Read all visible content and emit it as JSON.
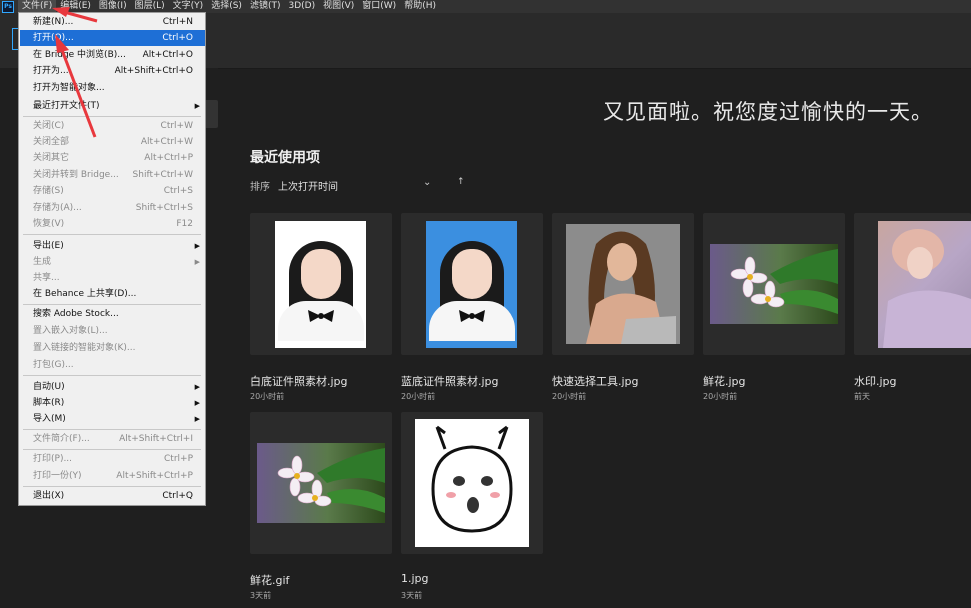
{
  "menubar": {
    "logo": "Ps",
    "items": [
      "文件(F)",
      "编辑(E)",
      "图像(I)",
      "图层(L)",
      "文字(Y)",
      "选择(S)",
      "滤镜(T)",
      "3D(D)",
      "视图(V)",
      "窗口(W)",
      "帮助(H)"
    ]
  },
  "welcome": "又见面啦。祝您度过愉快的一天。",
  "recent": {
    "title": "最近使用项",
    "sort_label": "排序",
    "sort_value": "上次打开时间",
    "sort_up": "↑",
    "files": [
      {
        "name": "白底证件照素材.jpg",
        "time": "20小时前"
      },
      {
        "name": "蓝底证件照素材.jpg",
        "time": "20小时前"
      },
      {
        "name": "快速选择工具.jpg",
        "time": "20小时前"
      },
      {
        "name": "鲜花.jpg",
        "time": "20小时前"
      },
      {
        "name": "水印.jpg",
        "time": "前天"
      },
      {
        "name": "鲜花.gif",
        "time": "3天前"
      },
      {
        "name": "1.jpg",
        "time": "3天前"
      }
    ]
  },
  "file_menu": {
    "items": [
      {
        "label": "新建(N)...",
        "shortcut": "Ctrl+N"
      },
      {
        "label": "打开(O)...",
        "shortcut": "Ctrl+O"
      },
      {
        "label": "在 Bridge 中浏览(B)...",
        "shortcut": "Alt+Ctrl+O"
      },
      {
        "label": "打开为...",
        "shortcut": "Alt+Shift+Ctrl+O"
      },
      {
        "label": "打开为智能对象...",
        "shortcut": ""
      },
      {
        "label": "最近打开文件(T)",
        "shortcut": ""
      },
      {
        "label": "关闭(C)",
        "shortcut": "Ctrl+W"
      },
      {
        "label": "关闭全部",
        "shortcut": "Alt+Ctrl+W"
      },
      {
        "label": "关闭其它",
        "shortcut": "Alt+Ctrl+P"
      },
      {
        "label": "关闭并转到 Bridge...",
        "shortcut": "Shift+Ctrl+W"
      },
      {
        "label": "存储(S)",
        "shortcut": "Ctrl+S"
      },
      {
        "label": "存储为(A)...",
        "shortcut": "Shift+Ctrl+S"
      },
      {
        "label": "恢复(V)",
        "shortcut": "F12"
      },
      {
        "label": "导出(E)",
        "shortcut": ""
      },
      {
        "label": "生成",
        "shortcut": ""
      },
      {
        "label": "共享...",
        "shortcut": ""
      },
      {
        "label": "在 Behance 上共享(D)...",
        "shortcut": ""
      },
      {
        "label": "搜索 Adobe Stock...",
        "shortcut": ""
      },
      {
        "label": "置入嵌入对象(L)...",
        "shortcut": ""
      },
      {
        "label": "置入链接的智能对象(K)...",
        "shortcut": ""
      },
      {
        "label": "打包(G)...",
        "shortcut": ""
      },
      {
        "label": "自动(U)",
        "shortcut": ""
      },
      {
        "label": "脚本(R)",
        "shortcut": ""
      },
      {
        "label": "导入(M)",
        "shortcut": ""
      },
      {
        "label": "文件简介(F)...",
        "shortcut": "Alt+Shift+Ctrl+I"
      },
      {
        "label": "打印(P)...",
        "shortcut": "Ctrl+P"
      },
      {
        "label": "打印一份(Y)",
        "shortcut": "Alt+Shift+Ctrl+P"
      },
      {
        "label": "退出(X)",
        "shortcut": "Ctrl+Q"
      }
    ]
  },
  "colors": {
    "accent": "#1e6fd6",
    "annotation_arrow": "#e8383d"
  }
}
